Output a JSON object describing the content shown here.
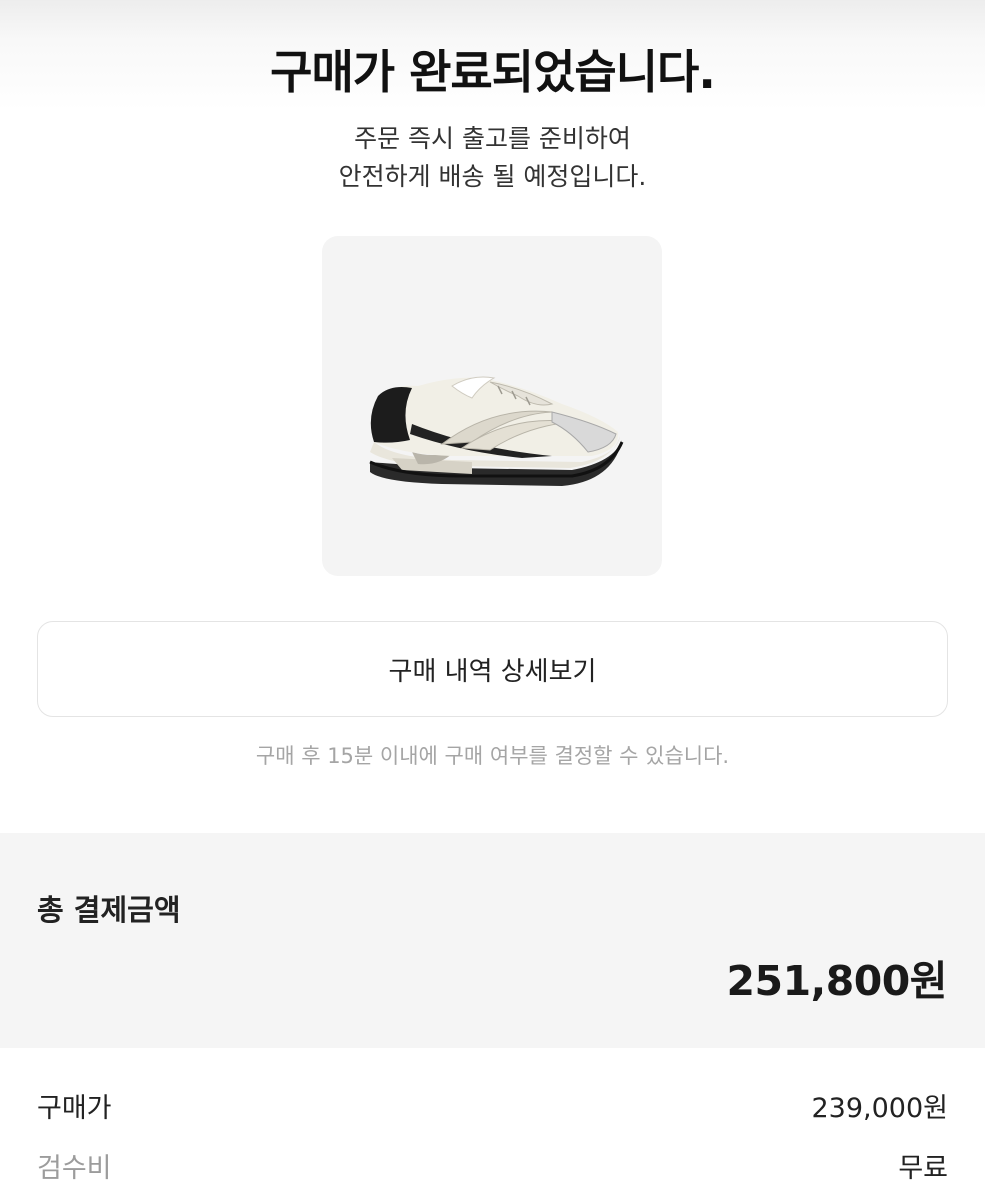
{
  "header": {
    "title": "구매가 완료되었습니다.",
    "subtitle_line1": "주문 즉시 출고를 준비하여",
    "subtitle_line2": "안전하게 배송 될 예정입니다."
  },
  "product": {
    "image": "sneaker-image"
  },
  "actions": {
    "detail_button_label": "구매 내역 상세보기"
  },
  "notice": {
    "text": "구매 후 15분 이내에 구매 여부를 결정할 수 있습니다."
  },
  "payment": {
    "total_label": "총 결제금액",
    "total_amount": "251,800원",
    "items": [
      {
        "label": "구매가",
        "value": "239,000원"
      },
      {
        "label": "검수비",
        "value": "무료"
      }
    ]
  },
  "colors": {
    "background": "#ffffff",
    "card_background": "#f4f4f4",
    "section_background": "#f5f5f5",
    "muted_text": "#a5a5a5"
  }
}
